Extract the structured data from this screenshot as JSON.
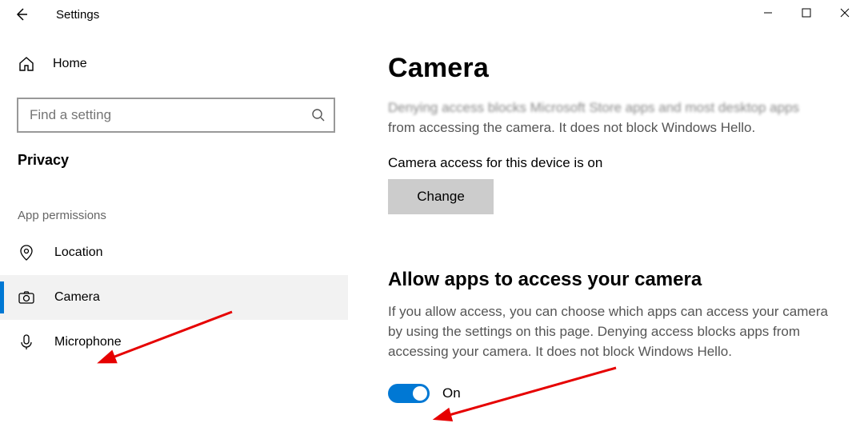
{
  "window": {
    "title": "Settings"
  },
  "sidebar": {
    "home_label": "Home",
    "search_placeholder": "Find a setting",
    "section_label": "Privacy",
    "group_label": "App permissions",
    "items": [
      {
        "label": "Location"
      },
      {
        "label": "Camera"
      },
      {
        "label": "Microphone"
      }
    ]
  },
  "main": {
    "page_title": "Camera",
    "faded_text": "Denying access blocks Microsoft Store apps and most desktop apps",
    "faded_text_line2": "from accessing the camera. It does not block Windows Hello.",
    "status_line": "Camera access for this device is on",
    "change_label": "Change",
    "section2_title": "Allow apps to access your camera",
    "section2_desc": "If you allow access, you can choose which apps can access your camera by using the settings on this page. Denying access blocks apps from accessing your camera. It does not block Windows Hello.",
    "toggle_label": "On"
  }
}
